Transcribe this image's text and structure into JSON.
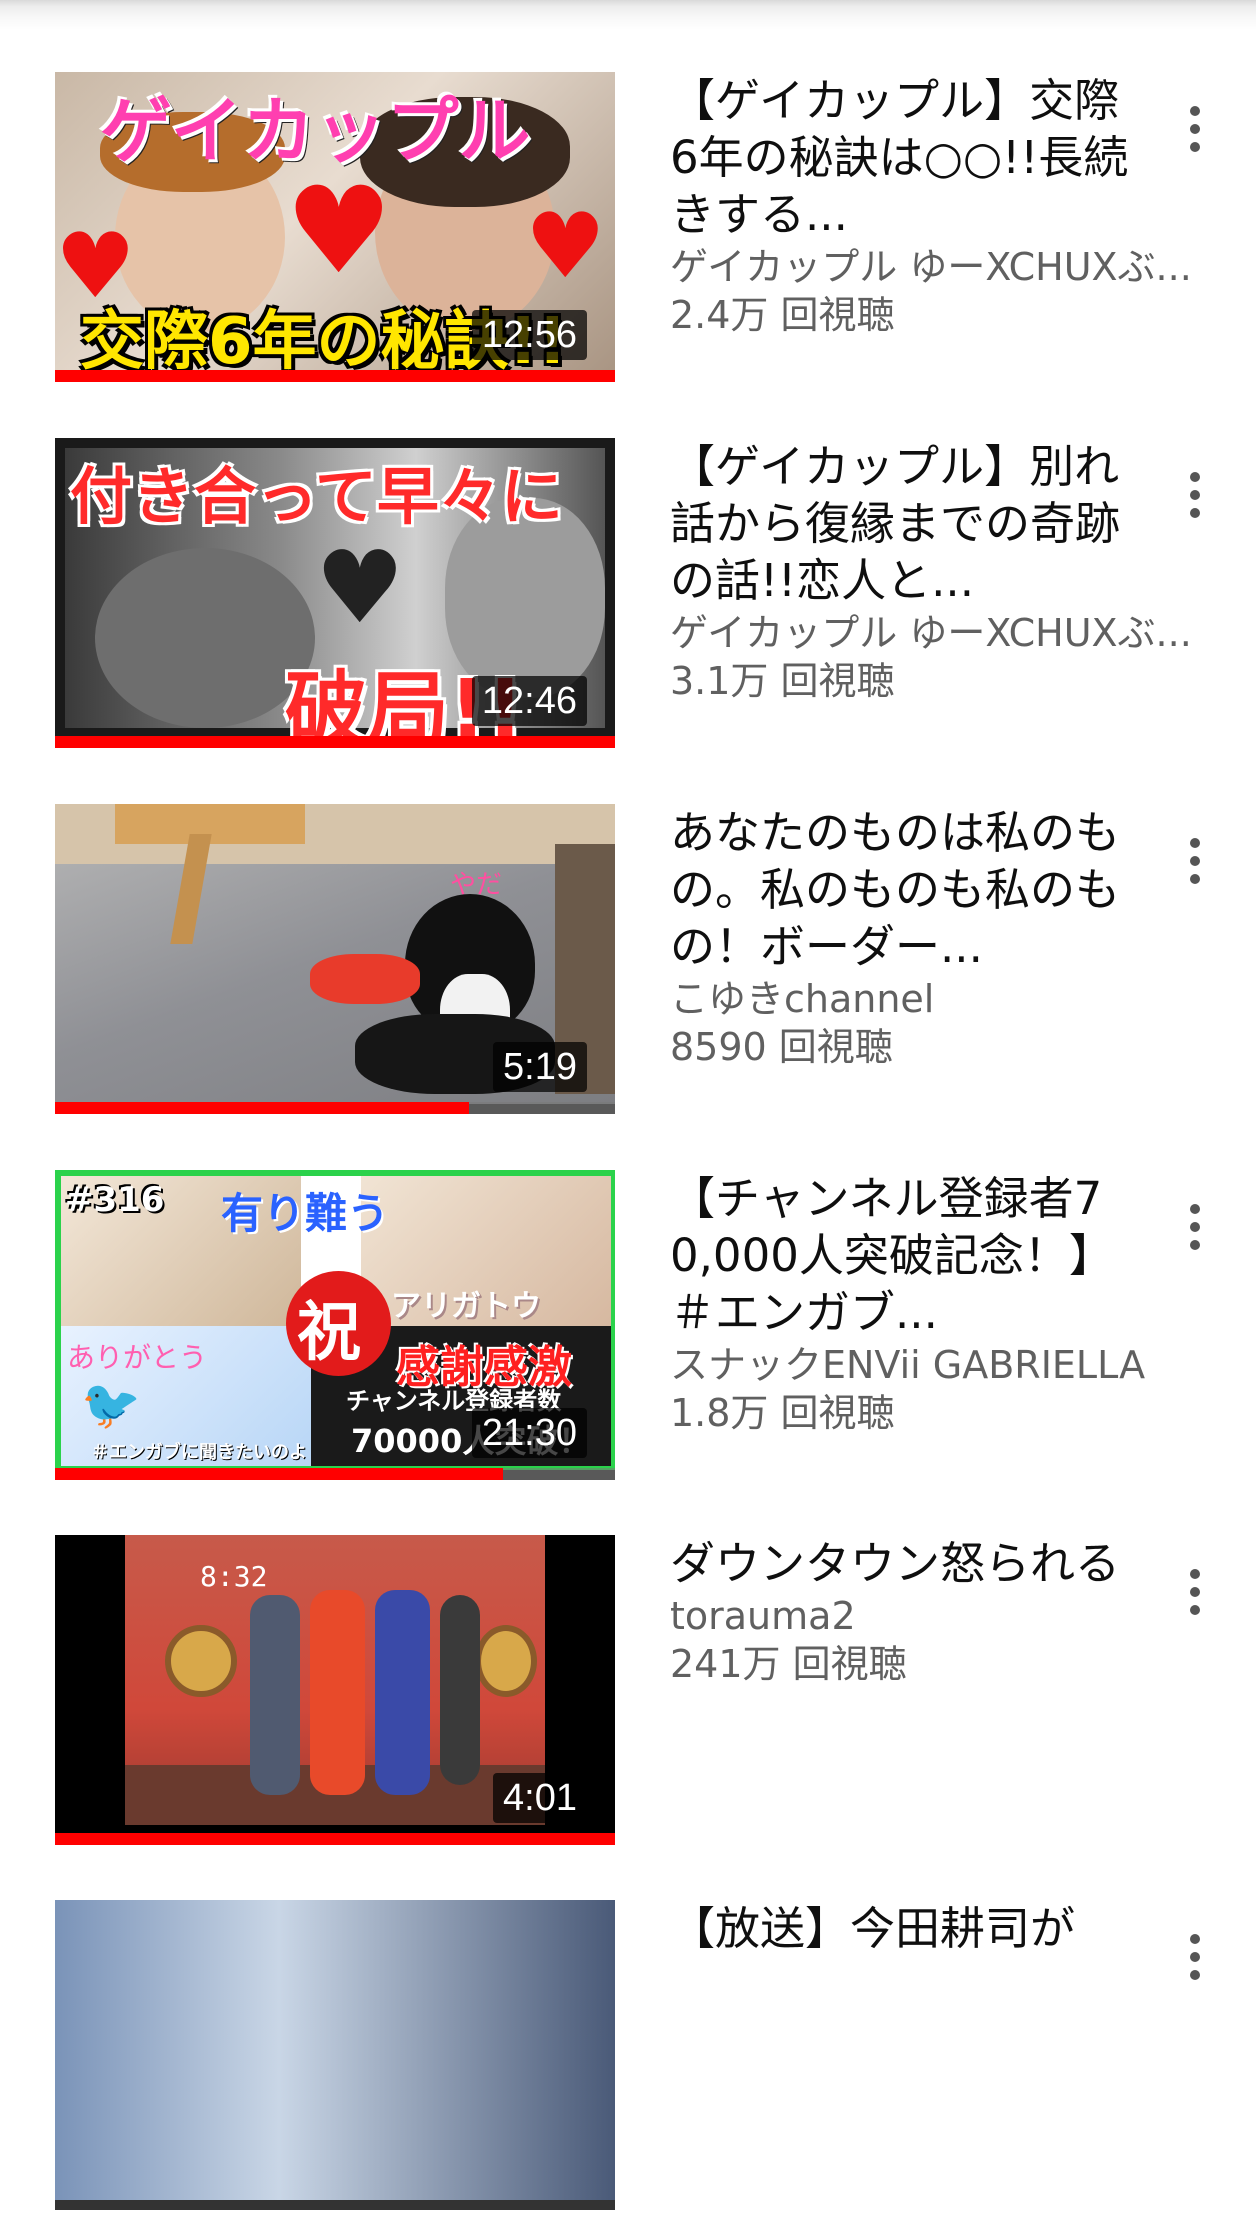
{
  "videos": [
    {
      "title": "【ゲイカップル】交際6年の秘訣は○○!!長続きする...",
      "channel": "ゲイカップル ゆーXCHUXぶ...",
      "views": "2.4万 回視聴",
      "duration": "12:56",
      "watched_fraction": 1.0,
      "thumb_text": [
        "ゲイカップル",
        "交際6年の秘訣!!"
      ]
    },
    {
      "title": "【ゲイカップル】別れ話から復縁までの奇跡の話!!恋人と...",
      "channel": "ゲイカップル ゆーXCHUXぶ...",
      "views": "3.1万 回視聴",
      "duration": "12:46",
      "watched_fraction": 1.0,
      "thumb_text": [
        "付き合って早々に",
        "破局!!"
      ]
    },
    {
      "title": "あなたのものは私のもの。私のものも私のもの！ボーダー...",
      "channel": "こゆきchannel",
      "views": "8590 回視聴",
      "duration": "5:19",
      "watched_fraction": 0.74,
      "thumb_text": [
        "やだ"
      ]
    },
    {
      "title": "【チャンネル登録者70,000人突破記念！】＃エンガブ...",
      "channel": "スナックENVii GABRIELLA",
      "views": "1.8万 回視聴",
      "duration": "21:30",
      "watched_fraction": 0.8,
      "thumb_text": [
        "#316",
        "有り難う",
        "祝",
        "感謝感激",
        "チャンネル登録者数",
        "70000人突破！",
        "ありがとう",
        "アリガトウ",
        "＃エンガブに聞きたいのよ"
      ]
    },
    {
      "title": "ダウンタウン怒られる",
      "channel": "torauma2",
      "views": "241万 回視聴",
      "duration": "4:01",
      "watched_fraction": 1.0,
      "thumb_text": [
        "8:32"
      ]
    },
    {
      "title": "【放送】今田耕司が",
      "channel": "",
      "views": "",
      "duration": "",
      "watched_fraction": 0,
      "thumb_text": []
    }
  ]
}
